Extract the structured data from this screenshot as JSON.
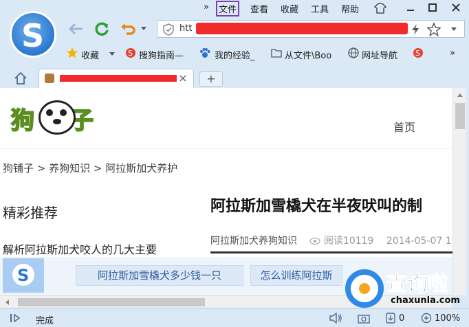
{
  "menu": {
    "chevrons": "»",
    "file": "文件",
    "view": "查看",
    "favorites": "收藏",
    "tools": "工具",
    "help": "帮助"
  },
  "address": {
    "prefix": "htt"
  },
  "favbar": {
    "favorites": "收藏",
    "sogou_guide": "搜狗指南—",
    "my_experience": "我的经验_",
    "from_file": "从文件\\Boo",
    "nav": "网址导航",
    "more": "»"
  },
  "tabs": {
    "new_tab": "+"
  },
  "page": {
    "site_logo": "狗   铺子",
    "home": "首页",
    "breadcrumb": "狗铺子   >   养狗知识   >   阿拉斯加犬养护",
    "recommend_title": "精彩推荐",
    "recommend_item": "解析阿拉斯加犬咬人的几大主要",
    "article_title": "阿拉斯加雪橇犬在半夜吠叫的制",
    "meta_category": "阿拉斯加犬养狗知识",
    "meta_reads": "阅读10119",
    "meta_date": "2014-05-07  1"
  },
  "floatbar": {
    "btn1": "阿拉斯加雪橇犬多少钱一只",
    "btn2": "怎么训练阿拉斯"
  },
  "status": {
    "text": "完成",
    "downloads": "0",
    "zoom": "100%"
  },
  "watermark": {
    "text": "查询啦",
    "sub": "chaxunla.com"
  },
  "colors": {
    "accent": "#2b78d0",
    "redaction": "#f12b2b",
    "menu_highlight": "#7b3fb5"
  }
}
